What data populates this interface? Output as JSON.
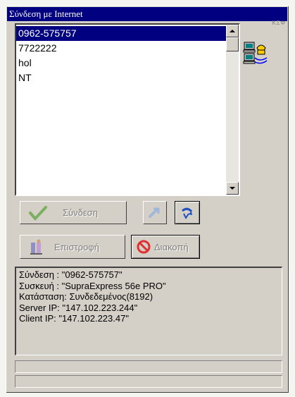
{
  "window": {
    "title": "Σύνδεση με Internet",
    "corner_text": "ΚΣΦ"
  },
  "connections": {
    "items": [
      "0962-575757",
      "7722222",
      "hol",
      "NT"
    ],
    "selected_index": 0
  },
  "buttons": {
    "connect_label": "Σύνδεση",
    "return_label": "Επιστροφή",
    "disconnect_label": "Διακοπή"
  },
  "info": {
    "lines": [
      "Σύνδεση : \"0962-575757\"",
      "Συσκευή : \"SupraExpress 56e PRO\"",
      "Κατάσταση: Συνδεδεμένος(8192)",
      "Server IP: \"147.102.223.244\"",
      "Client IP: \"147.102.223.47\""
    ]
  },
  "colors": {
    "title_bar": "#000080",
    "selection": "#000080",
    "face": "#d4d0c8"
  }
}
